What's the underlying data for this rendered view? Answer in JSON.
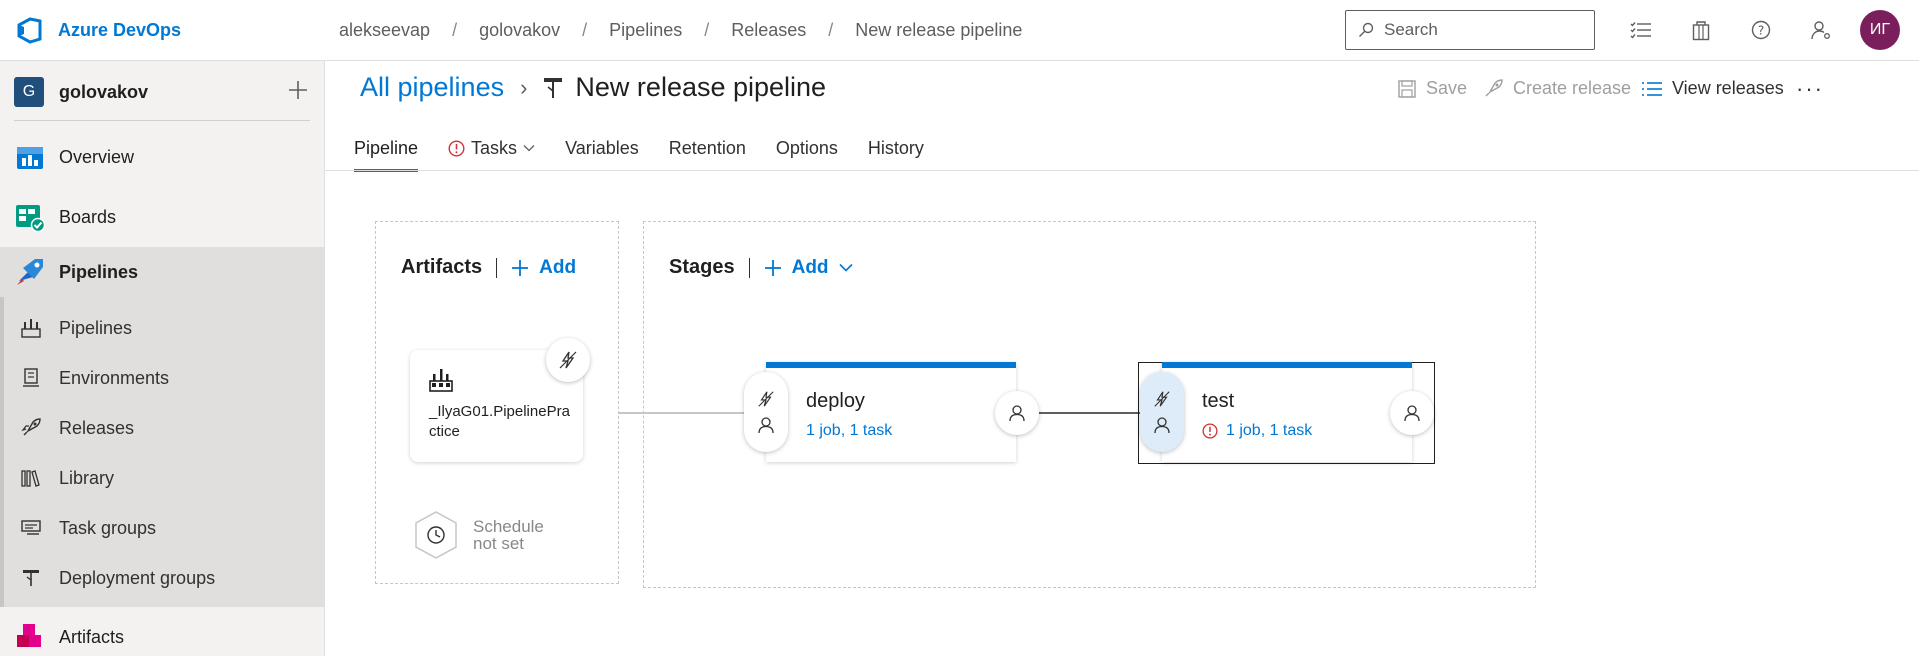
{
  "app": {
    "name": "Azure DevOps"
  },
  "breadcrumb": [
    "alekseevap",
    "golovakov",
    "Pipelines",
    "Releases",
    "New release pipeline"
  ],
  "search": {
    "placeholder": "Search"
  },
  "user": {
    "initials": "ИГ"
  },
  "project": {
    "initial": "G",
    "name": "golovakov"
  },
  "sidebar": {
    "items": [
      {
        "label": "Overview"
      },
      {
        "label": "Boards"
      },
      {
        "label": "Pipelines"
      }
    ],
    "pipeline_items": [
      {
        "label": "Pipelines"
      },
      {
        "label": "Environments"
      },
      {
        "label": "Releases"
      },
      {
        "label": "Library"
      },
      {
        "label": "Task groups"
      },
      {
        "label": "Deployment groups"
      }
    ],
    "artifacts_label": "Artifacts"
  },
  "header": {
    "all_pipelines": "All pipelines",
    "title": "New release pipeline"
  },
  "commands": {
    "save": "Save",
    "create_release": "Create release",
    "view_releases": "View releases"
  },
  "tabs": [
    "Pipeline",
    "Tasks",
    "Variables",
    "Retention",
    "Options",
    "History"
  ],
  "artifacts_section": {
    "title": "Artifacts",
    "add": "Add"
  },
  "artifact": {
    "name": "_IlyaG01.PipelinePractice"
  },
  "schedule": {
    "line1": "Schedule",
    "line2": "not set"
  },
  "stages_section": {
    "title": "Stages",
    "add": "Add"
  },
  "stages": [
    {
      "name": "deploy",
      "info": "1 job, 1 task",
      "warning": false
    },
    {
      "name": "test",
      "info": "1 job, 1 task",
      "warning": true
    }
  ],
  "colors": {
    "accent": "#0078d4",
    "avatar": "#7a1f5c",
    "warning": "#d13438"
  }
}
